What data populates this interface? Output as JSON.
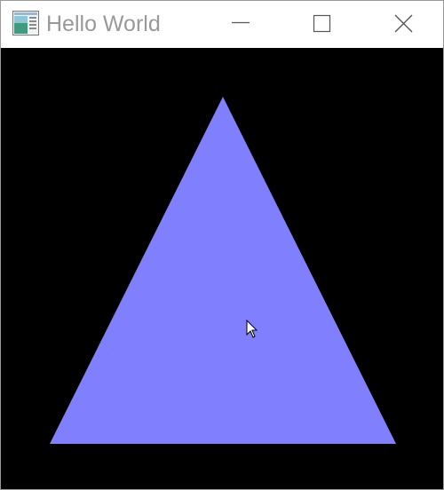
{
  "window": {
    "title": "Hello World",
    "controls": {
      "minimize": "minimize-icon",
      "maximize": "maximize-icon",
      "close": "close-icon"
    }
  },
  "scene": {
    "background_color": "#000000",
    "triangle_color": "#8080ff"
  }
}
